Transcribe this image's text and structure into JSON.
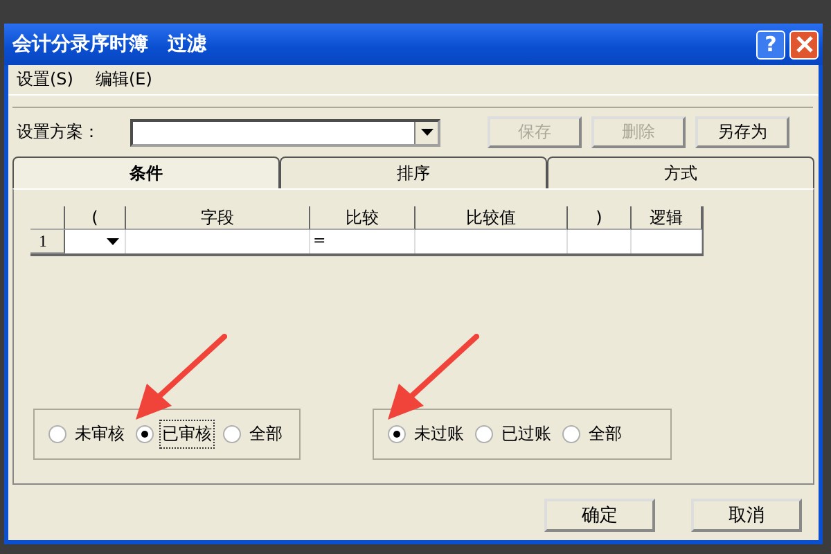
{
  "window": {
    "title": "会计分录序时簿　过滤",
    "help_button": "?"
  },
  "menu": [
    {
      "label": "设置(S)"
    },
    {
      "label": "编辑(E)"
    }
  ],
  "scheme": {
    "label": "设置方案："
  },
  "scheme_buttons": [
    {
      "label": "保存",
      "disabled": true
    },
    {
      "label": "删除",
      "disabled": true
    },
    {
      "label": "另存为",
      "disabled": false
    }
  ],
  "tabs": [
    {
      "label": "条件",
      "selected": true
    },
    {
      "label": "排序",
      "selected": false
    },
    {
      "label": "方式",
      "selected": false
    }
  ],
  "grid": {
    "columns": [
      "(",
      "字段",
      "比较",
      "比较值",
      ")",
      "逻辑"
    ],
    "rows": [
      {
        "number": "1",
        "compare": "="
      }
    ]
  },
  "radio_groups": [
    [
      {
        "label": "未审核",
        "selected": false,
        "marked": false
      },
      {
        "label": "已审核",
        "selected": true,
        "marked": true
      },
      {
        "label": "全部",
        "selected": false,
        "marked": false
      }
    ],
    [
      {
        "label": "未过账",
        "selected": true,
        "marked": true
      },
      {
        "label": "已过账",
        "selected": false,
        "marked": false
      },
      {
        "label": "全部",
        "selected": false,
        "marked": false
      }
    ]
  ],
  "buttons": [
    {
      "label": "确定"
    },
    {
      "label": "取消"
    }
  ]
}
